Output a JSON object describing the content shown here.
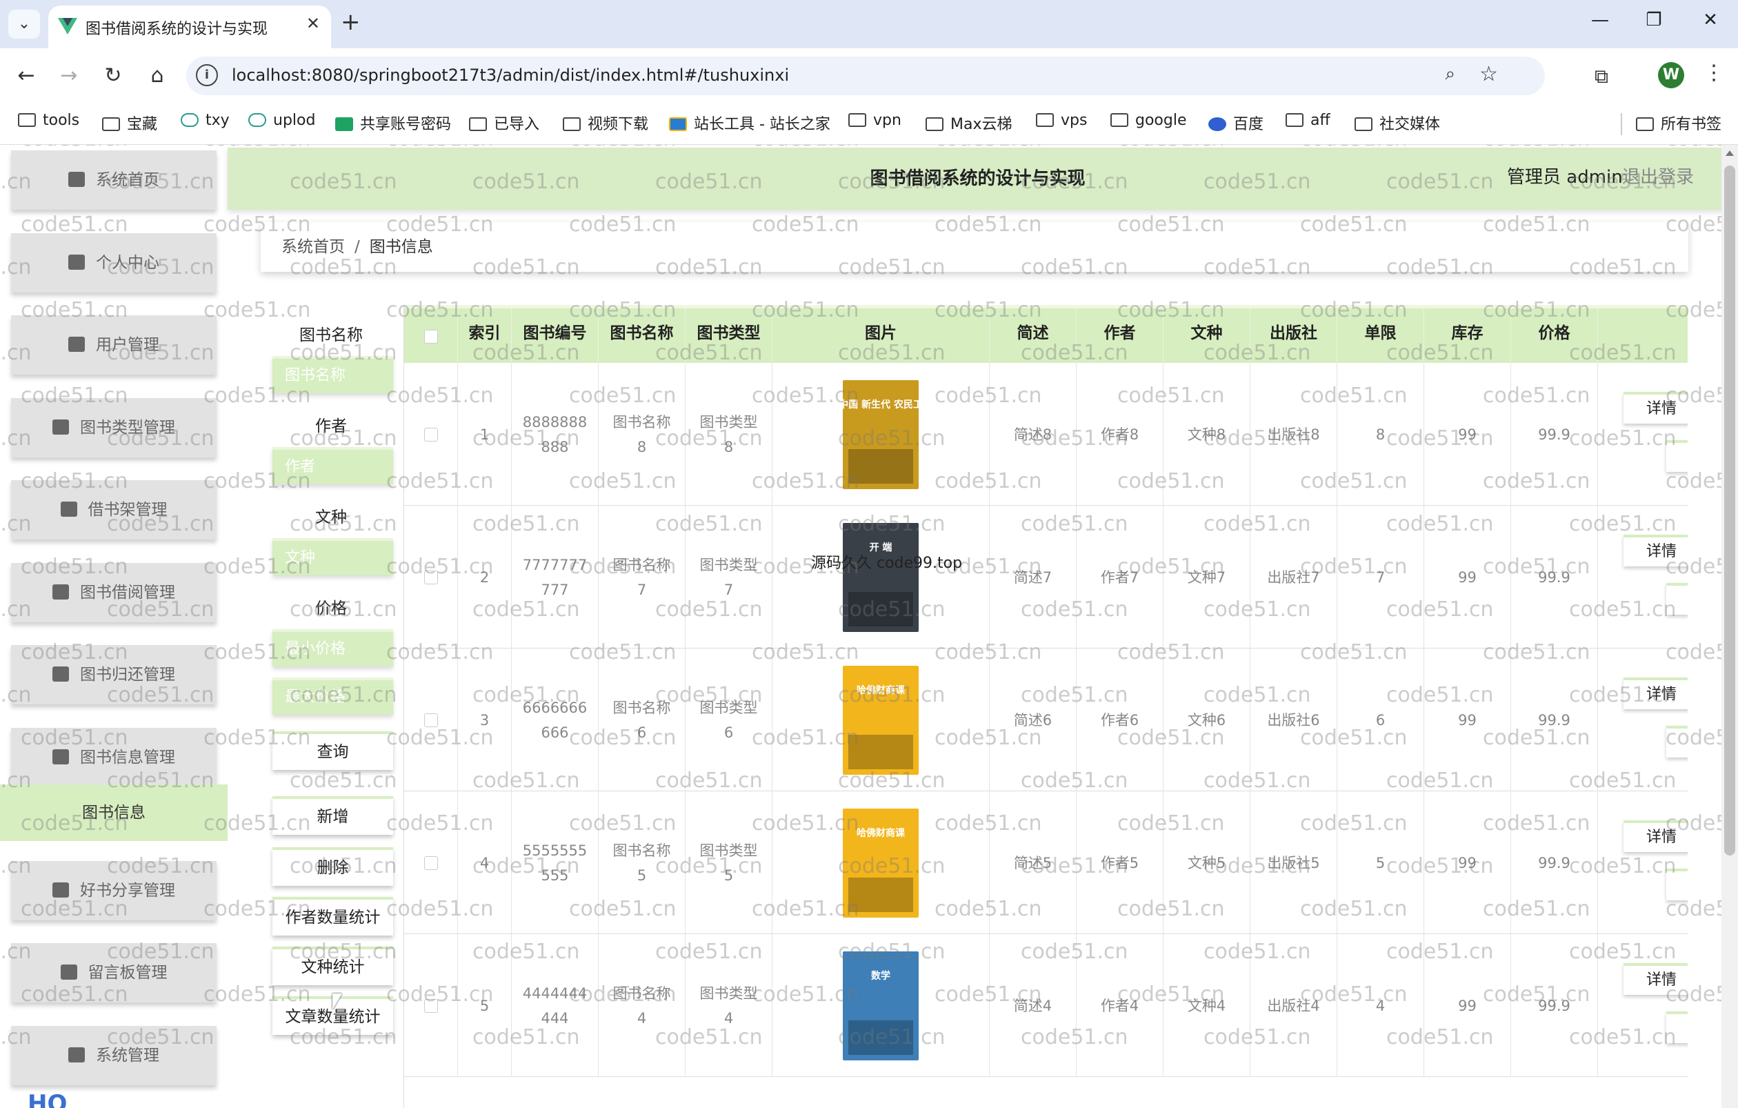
{
  "browser": {
    "tab_title": "图书借阅系统的设计与实现",
    "tab_close": "✕",
    "new_tab": "+",
    "url": "localhost:8080/springboot217t3/admin/dist/index.html#/tushuxinxi",
    "avatar_letter": "W",
    "bookmarks": [
      "tools",
      "宝藏",
      "txy",
      "uplod",
      "共享账号密码",
      "已导入",
      "视频下载",
      "站长工具 - 站长之家",
      "vpn",
      "Max云梯",
      "vps",
      "google",
      "百度",
      "aff",
      "社交媒体"
    ],
    "all_bookmarks": "所有书签"
  },
  "header": {
    "title": "图书借阅系统的设计与实现",
    "user": "管理员 admin",
    "logout": "退出登录"
  },
  "sidebar": {
    "items": [
      "系统首页",
      "个人中心",
      "用户管理",
      "图书类型管理",
      "借书架管理",
      "图书借阅管理",
      "图书归还管理",
      "图书信息管理"
    ],
    "active_sub": "图书信息",
    "items_after": [
      "好书分享管理",
      "留言板管理",
      "系统管理"
    ],
    "logo_text": "HQ"
  },
  "breadcrumb": {
    "home": "系统首页",
    "separator": "/",
    "current": "图书信息"
  },
  "search": {
    "label_name": "图书名称",
    "ph_name": "图书名称",
    "label_author": "作者",
    "ph_author": "作者",
    "label_lang": "文种",
    "ph_lang": "文种",
    "label_price": "价格",
    "ph_min_price": "最小价格",
    "ph_max_price": "最大价格",
    "query": "查询",
    "add": "新增",
    "delete": "删除",
    "stat_author": "作者数量统计",
    "stat_lang": "文种统计",
    "stat_article": "文章数量统计"
  },
  "table": {
    "headers": [
      "索引",
      "图书编号",
      "图书名称",
      "图书类型",
      "图片",
      "简述",
      "作者",
      "文种",
      "出版社",
      "单限",
      "库存",
      "价格"
    ],
    "detail_label": "详情",
    "rows": [
      {
        "index": "1",
        "code": "8888888\n888",
        "name": "图书名称\n8",
        "type": "图书类型\n8",
        "brief": "简述8",
        "author": "作者8",
        "lang": "文种8",
        "publisher": "出版社8",
        "limit": "8",
        "stock": "99",
        "price": "99.9",
        "cover_text": "中国 新生代 农民工",
        "cover_bg": "#c89a1e"
      },
      {
        "index": "2",
        "code": "7777777\n777",
        "name": "图书名称\n7",
        "type": "图书类型\n7",
        "brief": "简述7",
        "author": "作者7",
        "lang": "文种7",
        "publisher": "出版社7",
        "limit": "7",
        "stock": "99",
        "price": "99.9",
        "cover_text": "开 端",
        "cover_bg": "#3a4048"
      },
      {
        "index": "3",
        "code": "6666666\n666",
        "name": "图书名称\n6",
        "type": "图书类型\n6",
        "brief": "简述6",
        "author": "作者6",
        "lang": "文种6",
        "publisher": "出版社6",
        "limit": "6",
        "stock": "99",
        "price": "99.9",
        "cover_text": "哈佛财商课",
        "cover_bg": "#f2b51c"
      },
      {
        "index": "4",
        "code": "5555555\n555",
        "name": "图书名称\n5",
        "type": "图书类型\n5",
        "brief": "简述5",
        "author": "作者5",
        "lang": "文种5",
        "publisher": "出版社5",
        "limit": "5",
        "stock": "99",
        "price": "99.9",
        "cover_text": "哈佛财商课",
        "cover_bg": "#f2b51c"
      },
      {
        "index": "5",
        "code": "4444444\n444",
        "name": "图书名称\n4",
        "type": "图书类型\n4",
        "brief": "简述4",
        "author": "作者4",
        "lang": "文种4",
        "publisher": "出版社4",
        "limit": "4",
        "stock": "99",
        "price": "99.9",
        "cover_text": "数学",
        "cover_bg": "#3d7fb6"
      }
    ]
  },
  "watermark": {
    "text": "code51.cn",
    "overlay": "源码久久 code99.top"
  }
}
